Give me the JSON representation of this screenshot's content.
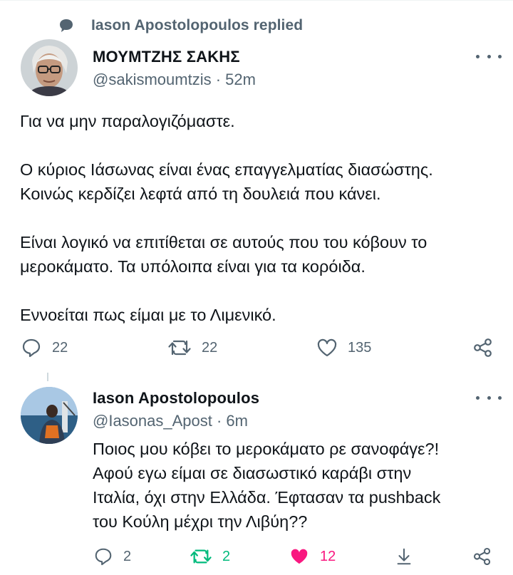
{
  "header": {
    "replied_text": "Iason Apostolopoulos replied",
    "icon": "speech-bubble-icon"
  },
  "tweet1": {
    "author_name": "ΜΟΥΜΤΖΗΣ ΣΑΚΗΣ",
    "handle_time": "@sakismoumtzis · 52m",
    "paragraphs": [
      [
        "Για να μην παραλογιζόμαστε."
      ],
      [
        "Ο κύριος Ιάσωνας είναι ένας επαγγελματίας διασώστης.",
        "Κοινώς κερδίζει λεφτά από τη δουλειά που κάνει."
      ],
      [
        "Είναι λογικό να επιτίθεται σε αυτούς που του κόβουν το",
        "μεροκάματο. Τα υπόλοιπα είναι για τα κορόιδα."
      ],
      [
        "Εννοείται πως είμαι με το Λιμενικό."
      ]
    ],
    "actions": {
      "replies": "22",
      "retweets": "22",
      "likes": "135"
    }
  },
  "tweet2": {
    "author_name": "Iason Apostolopoulos",
    "handle_time": "@Iasonas_Apost · 6m",
    "lines": [
      "Ποιος μου κόβει το μεροκάματο ρε σανοφάγε?!",
      "Αφού εγω είμαι σε διασωστικό καράβι στην",
      "Ιταλία, όχι στην Ελλάδα. Έφτασαν τα pushback",
      "του Κούλη μέχρι την Λιβύη??"
    ],
    "actions": {
      "replies": "2",
      "retweets": "2",
      "likes": "12"
    }
  },
  "colors": {
    "text": "#0f1419",
    "secondary": "#536471",
    "retweet_active": "#00ba7c",
    "like_active": "#f91880"
  }
}
